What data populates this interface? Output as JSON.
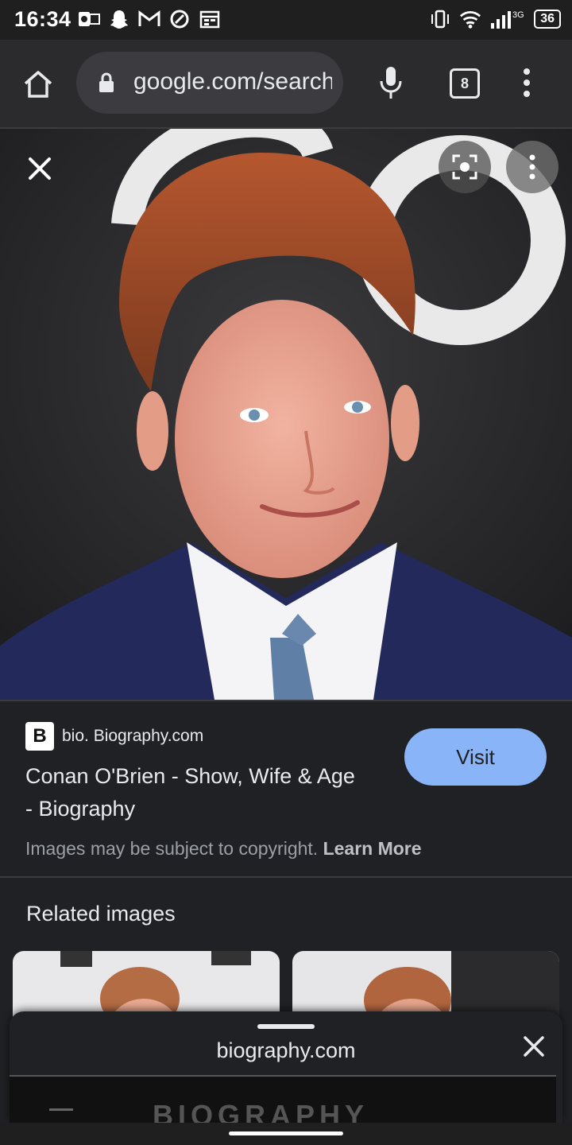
{
  "status_bar": {
    "time": "16:34",
    "battery": "36",
    "network": "3G",
    "icons": [
      "outlook-icon",
      "snapchat-icon",
      "gmail-icon",
      "threads-icon",
      "calendar-icon",
      "vibrate-icon",
      "wifi-icon",
      "signal-icon",
      "battery-icon"
    ]
  },
  "browser": {
    "url": "google.com/search",
    "tab_count": "8"
  },
  "result": {
    "source": "bio. Biography.com",
    "favicon_letter": "B",
    "title": "Conan O'Brien - Show, Wife & Age - Biography",
    "visit_label": "Visit",
    "copyright_text": "Images may be subject to copyright.",
    "learn_more": "Learn More"
  },
  "related": {
    "title": "Related images"
  },
  "sheet": {
    "title": "biography.com",
    "content_wordmark": "BIOGRAPHY"
  },
  "colors": {
    "background": "#202124",
    "accent": "#8ab4f8"
  }
}
